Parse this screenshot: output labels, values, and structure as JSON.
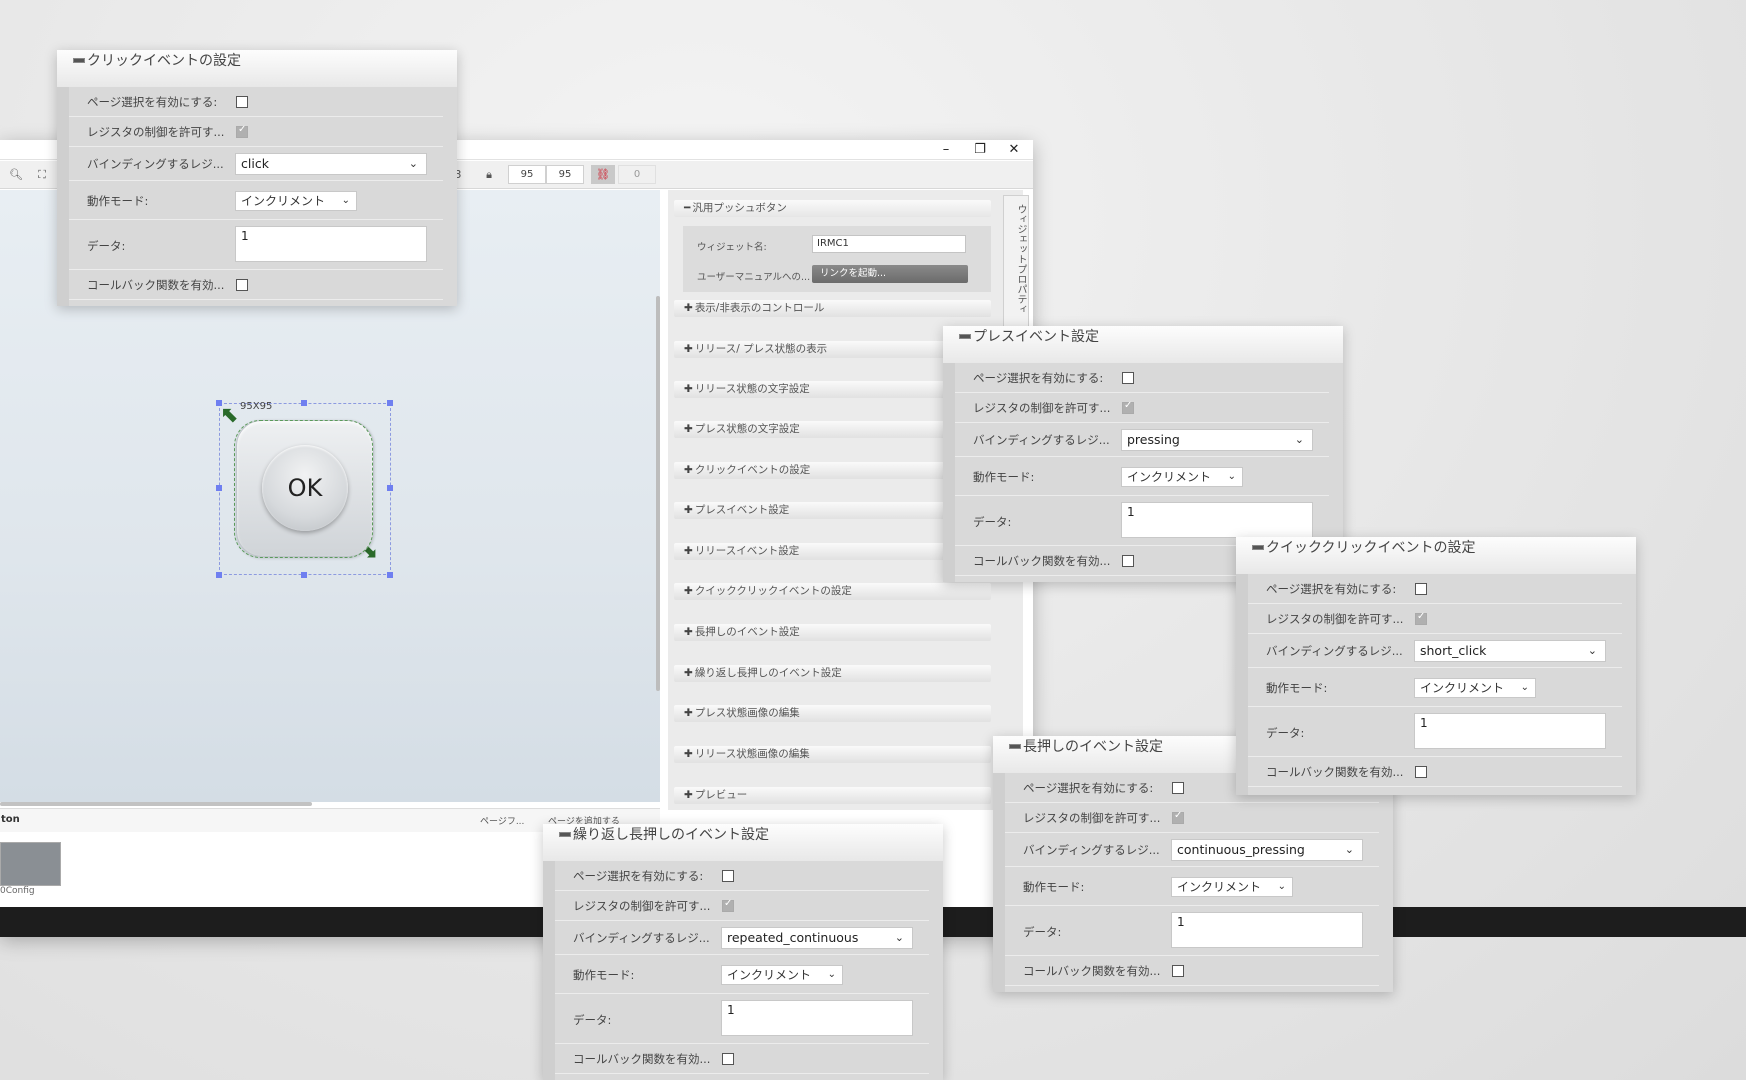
{
  "window": {
    "minimize": "–",
    "maximize": "❐",
    "close": "✕"
  },
  "toolbar": {
    "zoom_icon": "search-icon",
    "fit_icon": "fullscreen-icon",
    "partial_value": "3",
    "width": "95",
    "height": "95",
    "rotation": "0"
  },
  "canvas": {
    "widget_tag": "95X95",
    "ok_label": "OK"
  },
  "pagebar": {
    "title": "ton",
    "page_fit": "ページフ...",
    "add_page": "ページを追加する",
    "thumb_label": "0Config"
  },
  "properties": {
    "tab_label": "ウィジェットプロパティ",
    "main_section": "汎用プッシュボタン",
    "widget_name_label": "ウィジェット名:",
    "widget_name_value": "IRMC1",
    "manual_label": "ユーザーマニュアルへの...",
    "manual_button": "リンクを起動...",
    "sections": [
      "表示/非表示のコントロール",
      "リリース/ プレス状態の表示",
      "リリース状態の文字設定",
      "プレス状態の文字設定",
      "クリックイベントの設定",
      "プレスイベント設定",
      "リリースイベント設定",
      "クイッククリックイベントの設定",
      "長押しのイベント設定",
      "繰り返し長押しのイベント設定",
      "プレス状態画像の編集",
      "リリース状態画像の編集",
      "プレビュー"
    ]
  },
  "labels": {
    "page_select": "ページ選択を有効にする:",
    "register_control": "レジスタの制御を許可す...",
    "binding": "バインディングするレジ...",
    "mode": "動作モード:",
    "data": "データ:",
    "callback": "コールバック関数を有効..."
  },
  "dialogs": {
    "click": {
      "title": "クリックイベントの設定",
      "binding": "click",
      "mode": "インクリメント",
      "data": "1"
    },
    "press": {
      "title": "プレスイベント設定",
      "binding": "pressing",
      "mode": "インクリメント",
      "data": "1"
    },
    "quick": {
      "title": "クイッククリックイベントの設定",
      "binding": "short_click",
      "mode": "インクリメント",
      "data": "1"
    },
    "long": {
      "title": "長押しのイベント設定",
      "binding": "continuous_pressing",
      "mode": "インクリメント",
      "data": "1"
    },
    "repeat": {
      "title": "繰り返し長押しのイベント設定",
      "binding": "repeated_continuous",
      "mode": "インクリメント",
      "data": "1"
    }
  }
}
